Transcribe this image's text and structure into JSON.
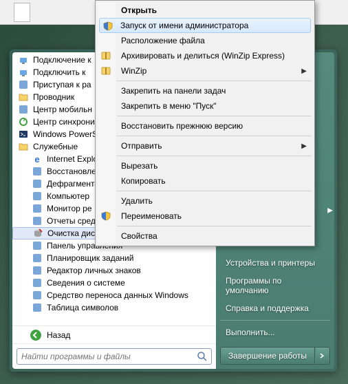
{
  "start_menu": {
    "programs": [
      {
        "icon": "connection-icon",
        "label": "Подключение к"
      },
      {
        "icon": "connection-icon",
        "label": "Подключить к"
      },
      {
        "icon": "doc-icon",
        "label": "Приступая к ра"
      },
      {
        "icon": "folder-icon",
        "label": "Проводник"
      },
      {
        "icon": "mobility-icon",
        "label": "Центр мобильн"
      },
      {
        "icon": "sync-icon",
        "label": "Центр синхрони"
      },
      {
        "icon": "powershell-icon",
        "label": "Windows PowerS"
      },
      {
        "icon": "folder-icon",
        "label": "Служебные"
      }
    ],
    "sub_programs": [
      {
        "icon": "ie-icon",
        "label": "Internet Explorer"
      },
      {
        "icon": "restore-icon",
        "label": "Восстановлен"
      },
      {
        "icon": "defrag-icon",
        "label": "Дефрагмента"
      },
      {
        "icon": "computer-icon",
        "label": "Компьютер"
      },
      {
        "icon": "monitor-icon",
        "label": "Монитор ре"
      },
      {
        "icon": "report-icon",
        "label": "Отчеты сред"
      },
      {
        "icon": "cleanup-icon",
        "label": "Очистка диск",
        "selected": true
      },
      {
        "icon": "cpanel-icon",
        "label": "Панель управления"
      },
      {
        "icon": "scheduler-icon",
        "label": "Планировщик заданий"
      },
      {
        "icon": "chars-icon",
        "label": "Редактор личных знаков"
      },
      {
        "icon": "sysinfo-icon",
        "label": "Сведения о системе"
      },
      {
        "icon": "transfer-icon",
        "label": "Средство переноса данных Windows"
      },
      {
        "icon": "charmap-icon",
        "label": "Таблица символов"
      }
    ],
    "back_label": "Назад",
    "search_placeholder": "Найти программы и файлы"
  },
  "right_panel": {
    "items": [
      "Устройства и принтеры",
      "Программы по умолчанию",
      "Справка и поддержка",
      "Выполнить..."
    ],
    "shutdown_label": "Завершение работы"
  },
  "context_menu": {
    "groups": [
      [
        {
          "label": "Открыть",
          "bold": true
        },
        {
          "label": "Запуск от имени администратора",
          "icon": "shield",
          "hover": true
        },
        {
          "label": "Расположение файла"
        },
        {
          "label": "Архивировать и делиться (WinZip Express)",
          "icon": "winzip"
        },
        {
          "label": "WinZip",
          "icon": "winzip",
          "submenu": true
        }
      ],
      [
        {
          "label": "Закрепить на панели задач"
        },
        {
          "label": "Закрепить в меню \"Пуск\""
        }
      ],
      [
        {
          "label": "Восстановить прежнюю версию"
        }
      ],
      [
        {
          "label": "Отправить",
          "submenu": true
        }
      ],
      [
        {
          "label": "Вырезать"
        },
        {
          "label": "Копировать"
        }
      ],
      [
        {
          "label": "Удалить"
        },
        {
          "label": "Переименовать",
          "icon": "shield"
        }
      ],
      [
        {
          "label": "Свойства"
        }
      ]
    ]
  }
}
